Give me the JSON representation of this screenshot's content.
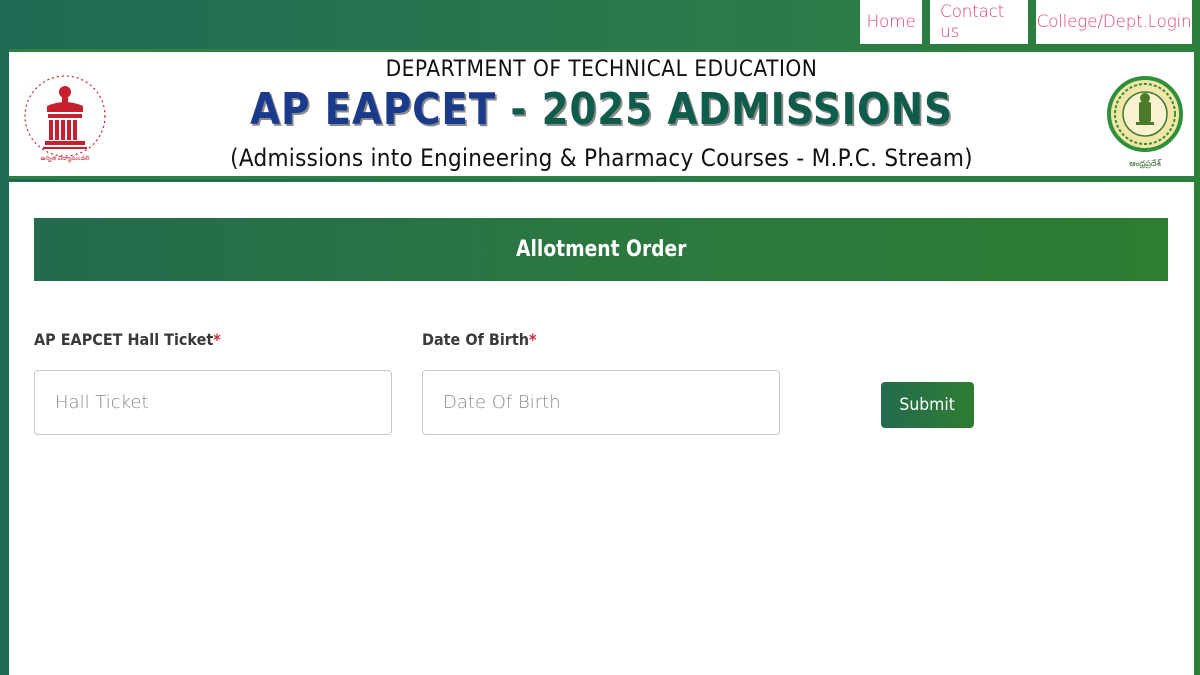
{
  "nav": {
    "home": "Home",
    "contact": "Contact us",
    "college_login": "College/Dept.Login"
  },
  "header": {
    "department": "DEPARTMENT OF TECHNICAL EDUCATION",
    "title_part1": "AP EAPCET",
    "title_part2": " - 2025 ADMISSIONS",
    "subtitle": "(Admissions into Engineering & Pharmacy Courses - M.P.C. Stream)",
    "left_logo_icon": "apsche-emblem-icon",
    "left_logo_text": "ANDHRA PRADESH STATE COUNCIL OF HIGHER EDUCATION",
    "right_logo_icon": "andhra-pradesh-state-emblem-icon"
  },
  "page": {
    "title": "Allotment Order"
  },
  "form": {
    "hall_ticket_label": "AP EAPCET Hall Ticket",
    "hall_ticket_placeholder": "Hall Ticket",
    "hall_ticket_value": "",
    "dob_label": "Date Of Birth",
    "dob_placeholder": "Date Of Birth",
    "dob_value": "",
    "required_marker": "*",
    "submit_label": "Submit"
  },
  "colors": {
    "brand_green": "#2e7d32",
    "teal_green": "#1f6a55",
    "nav_link": "#e0457b",
    "required": "#d6263b"
  }
}
